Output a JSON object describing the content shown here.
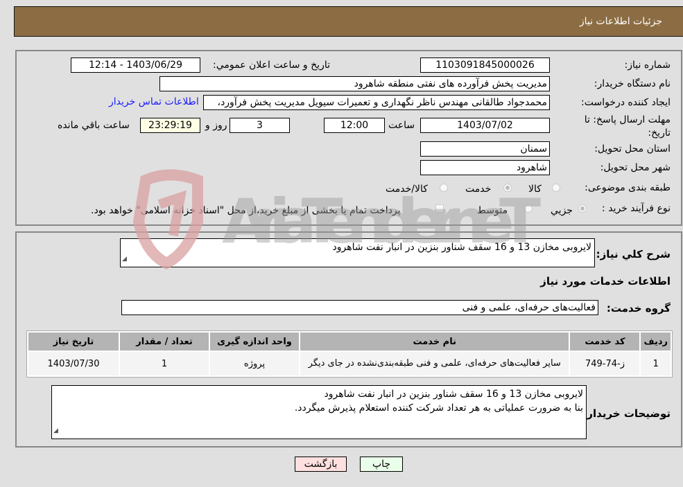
{
  "header": {
    "title": "جزئیات اطلاعات نیاز"
  },
  "details": {
    "need_number_label": "شماره نیاز:",
    "need_number": "1103091845000026",
    "announce_label": "تاریخ و ساعت اعلان عمومي:",
    "announce_value": "1403/06/29 - 12:14",
    "buyer_org_label": "نام دستگاه خریدار:",
    "buyer_org": "مدیریت پخش فرآورده های نفتی منطقه شاهرود",
    "creator_label": "ایجاد کننده درخواست:",
    "creator": "محمدجواد طالقانی مهندس ناظر نگهداری و تعمیرات سیویل مدیریت پخش فرآورد،",
    "contact_link": "اطلاعات تماس خریدار",
    "deadline_label": "مهلت ارسال پاسخ: تا تاریخ:",
    "deadline_date": "1403/07/02",
    "time_label": "ساعت",
    "deadline_time": "12:00",
    "days_value": "3",
    "days_label": "روز و",
    "remaining_time": "23:29:19",
    "remaining_label": "ساعت باقي مانده",
    "province_label": "استان محل تحویل:",
    "province": "سمنان",
    "city_label": "شهر محل تحویل:",
    "city": "شاهرود",
    "category_label": "طبقه بندی موضوعی:",
    "category_options": [
      {
        "label": "کالا",
        "checked": false
      },
      {
        "label": "خدمت",
        "checked": true
      },
      {
        "label": "کالا/خدمت",
        "checked": false
      }
    ],
    "process_label": "نوع فرآیند خرید :",
    "process_options": [
      {
        "label": "جزيي",
        "checked": true
      },
      {
        "label": "متوسط",
        "checked": false
      }
    ],
    "treasury_note": "پرداخت تمام یا بخشی از مبلغ خرید،از محل \"اسناد خزانه اسلامی\" خواهد بود."
  },
  "summary": {
    "description_label": "شرح کلي نیاز:",
    "description": "لایروبی مخازن 13 و 16 سقف شناور بنزین در انبار نفت شاهرود",
    "services_title": "اطلاعات خدمات مورد نیاز",
    "service_group_label": "گروه خدمت:",
    "service_group": "فعالیت‌های حرفه‌ای، علمی و فنی"
  },
  "table": {
    "headers": [
      "ردیف",
      "کد خدمت",
      "نام خدمت",
      "واحد اندازه گیری",
      "تعداد / مقدار",
      "تاریخ نیاز"
    ],
    "rows": [
      [
        "1",
        "ز-74-749",
        "سایر فعالیت‌های حرفه‌ای، علمی و فنی طبقه‌بندی‌نشده در جای دیگر",
        "پروژه",
        "1",
        "1403/07/30"
      ]
    ]
  },
  "buyer_notes": {
    "label": "توضیحات خریدار:",
    "line1": "لایروبی مخازن 13 و 16 سقف شناور بنزین در انبار نفت شاهرود",
    "line2": "بنا به ضرورت عملیاتی به هر تعداد شرکت کننده استعلام پذیرش میگردد."
  },
  "buttons": {
    "print": "چاپ",
    "back": "بازگشت"
  },
  "watermark": {
    "text": "AriaTender.neT"
  }
}
